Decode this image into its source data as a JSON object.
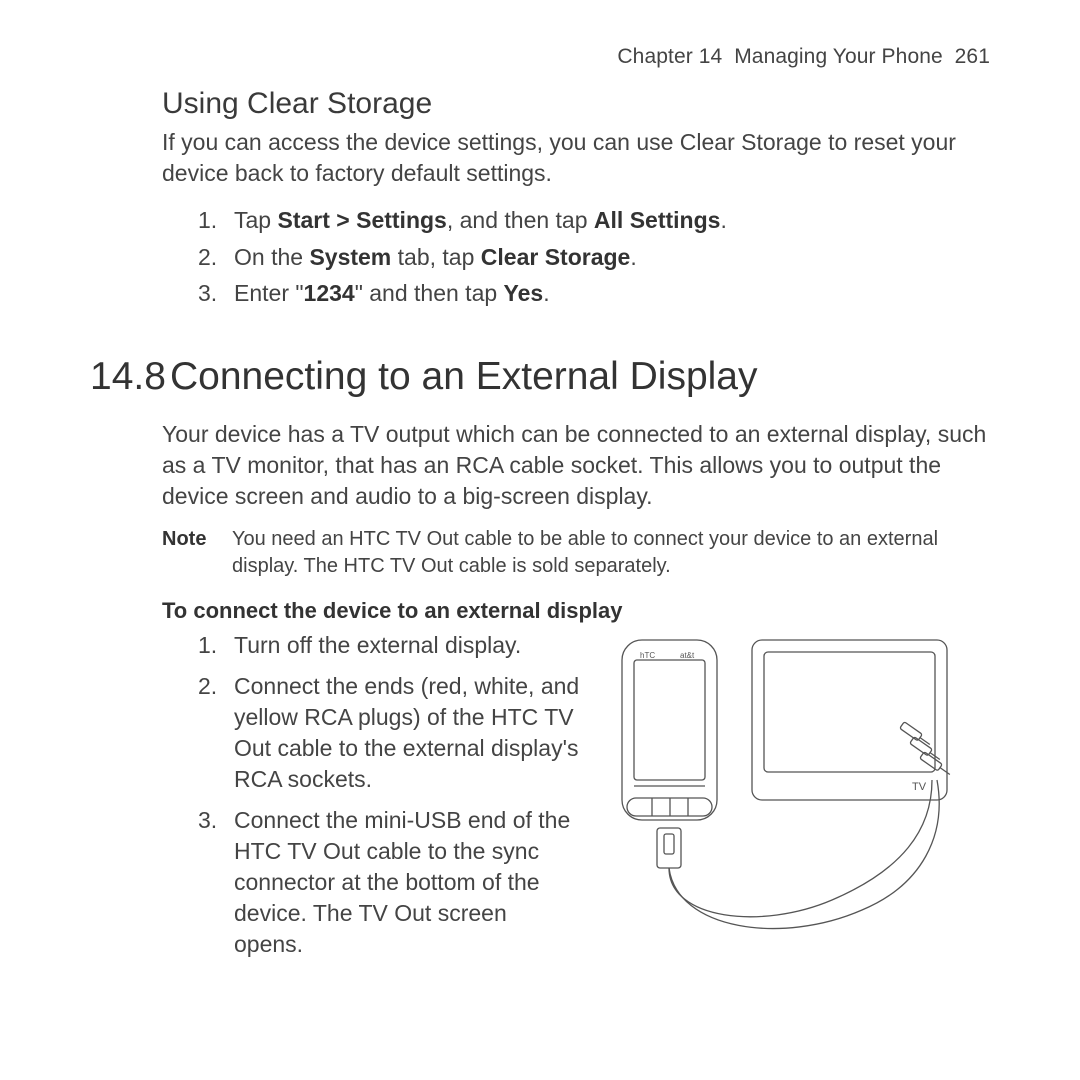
{
  "header": {
    "chapter_label": "Chapter 14",
    "chapter_title": "Managing Your Phone",
    "page_number": "261"
  },
  "section_clear_storage": {
    "heading": "Using Clear Storage",
    "intro": "If you can access the device settings, you can use Clear Storage to reset your device back to factory default settings.",
    "steps": [
      {
        "pre": "Tap ",
        "b1": "Start > Settings",
        "mid": ", and then tap ",
        "b2": "All Settings",
        "post": "."
      },
      {
        "pre": "On the ",
        "b1": "System",
        "mid": " tab, tap ",
        "b2": "Clear Storage",
        "post": "."
      },
      {
        "pre": "Enter \"",
        "b1": "1234",
        "mid": "\" and then tap ",
        "b2": "Yes",
        "post": "."
      }
    ]
  },
  "section_ext_display": {
    "number": "14.8",
    "heading": "Connecting to an External Display",
    "intro": "Your device has a TV output which can be connected to an external display, such as a TV monitor, that has an RCA cable socket. This allows you to output the device screen and audio to a big-screen display.",
    "note_label": "Note",
    "note": "You need an HTC TV Out cable to be able to connect your device to an external display. The HTC TV Out cable is sold separately.",
    "sub_heading": "To connect the device to an external display",
    "steps": [
      "Turn off the external display.",
      "Connect the ends (red, white, and yellow RCA plugs) of the HTC TV Out cable to the external display's RCA sockets.",
      "Connect the mini-USB end of the HTC TV Out cable to the sync connector at the bottom of the device. The TV Out screen opens."
    ],
    "illustration_labels": {
      "phone_brand": "hTC",
      "carrier": "at&t",
      "tv_label": "TV"
    }
  }
}
